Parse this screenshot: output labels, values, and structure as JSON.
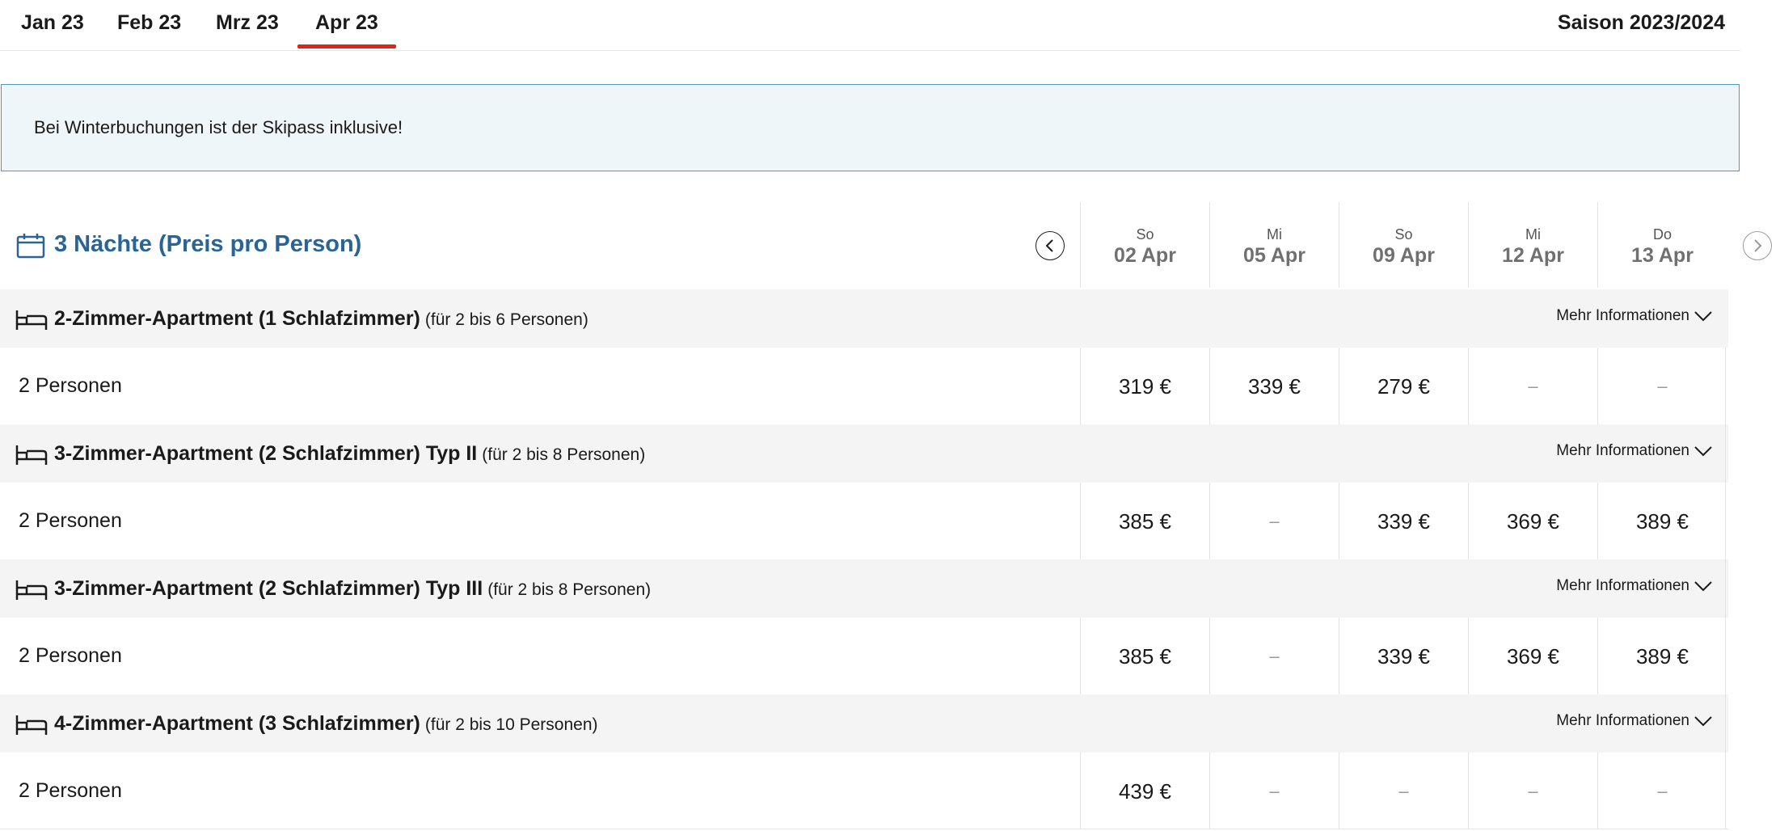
{
  "tabs": [
    {
      "label": "Jan 23"
    },
    {
      "label": "Feb 23"
    },
    {
      "label": "Mrz 23"
    },
    {
      "label": "Apr 23"
    }
  ],
  "season": "Saison 2023/2024",
  "banner": {
    "text": "Bei Winterbuchungen ist der Skipass inklusive!"
  },
  "header": {
    "title": "3 Nächte (Preis pro Person)",
    "dates": [
      {
        "weekday": "So",
        "date": "02 Apr"
      },
      {
        "weekday": "Mi",
        "date": "05 Apr"
      },
      {
        "weekday": "So",
        "date": "09 Apr"
      },
      {
        "weekday": "Mi",
        "date": "12 Apr"
      },
      {
        "weekday": "Do",
        "date": "13 Apr"
      }
    ]
  },
  "categories": [
    {
      "name": "2-Zimmer-Apartment (1 Schlafzimmer)",
      "capacity": "(für 2 bis 6 Personen)",
      "more_info": "Mehr Informationen",
      "persons": "2 Personen",
      "prices": [
        "319 €",
        "339 €",
        "279 €",
        "–",
        "–"
      ]
    },
    {
      "name": "3-Zimmer-Apartment (2 Schlafzimmer) Typ II",
      "capacity": "(für 2 bis 8 Personen)",
      "more_info": "Mehr Informationen",
      "persons": "2 Personen",
      "prices": [
        "385 €",
        "–",
        "339 €",
        "369 €",
        "389 €"
      ]
    },
    {
      "name": "3-Zimmer-Apartment (2 Schlafzimmer) Typ III",
      "capacity": "(für 2 bis 8 Personen)",
      "more_info": "Mehr Informationen",
      "persons": "2 Personen",
      "prices": [
        "385 €",
        "–",
        "339 €",
        "369 €",
        "389 €"
      ]
    },
    {
      "name": "4-Zimmer-Apartment (3 Schlafzimmer)",
      "capacity": "(für 2 bis 10 Personen)",
      "more_info": "Mehr Informationen",
      "persons": "2 Personen",
      "prices": [
        "439 €",
        "–",
        "–",
        "–",
        "–"
      ]
    }
  ],
  "icons": {
    "calendar": "calendar-icon",
    "bed": "bed-icon",
    "prev": "chevron-left-icon",
    "next": "chevron-right-icon",
    "expand": "chevron-down-icon"
  },
  "colors": {
    "active_tab_underline": "#e2231a",
    "title_blue": "#2a6496",
    "banner_bg": "#eef6fa",
    "banner_border": "#4e97c7"
  }
}
